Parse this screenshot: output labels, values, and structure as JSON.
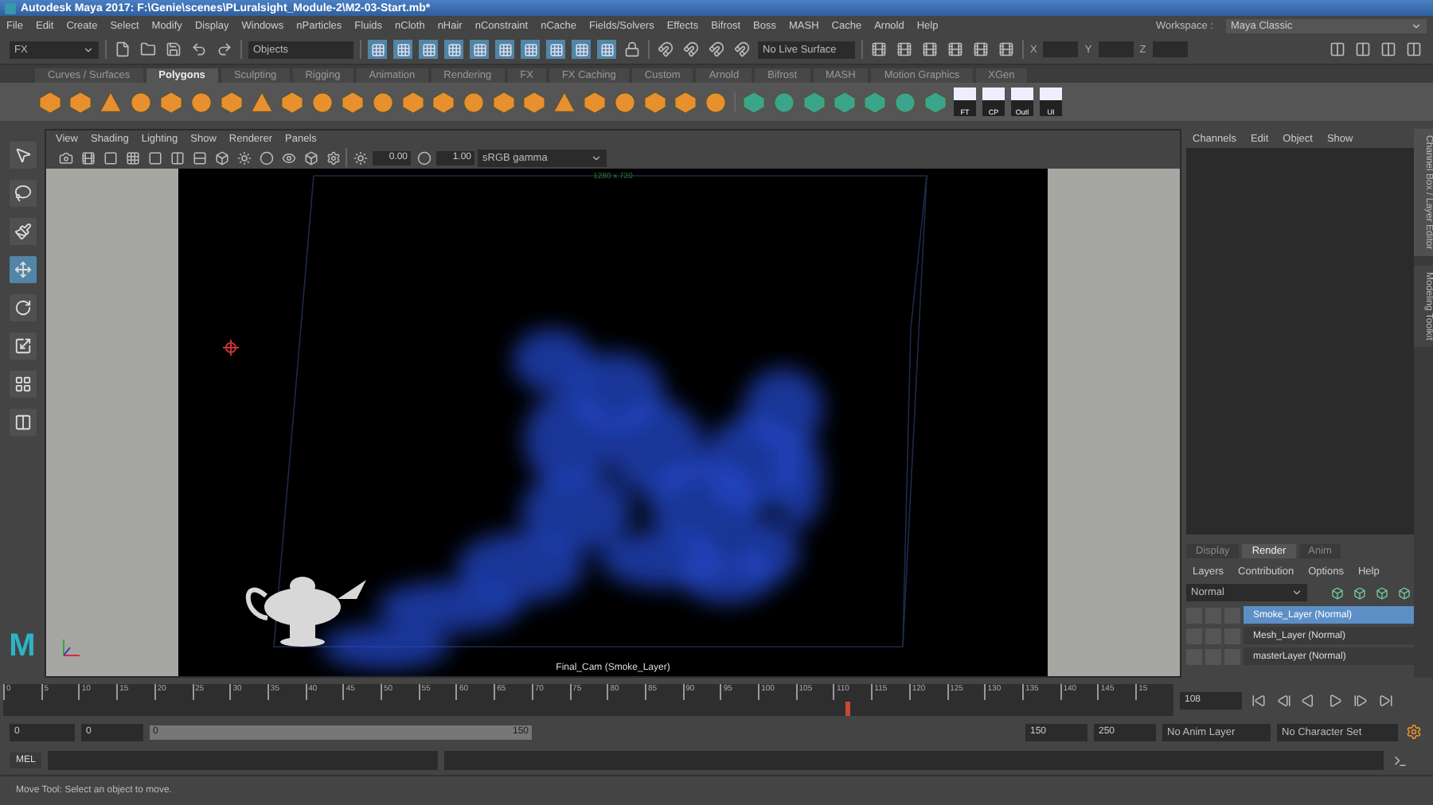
{
  "window": {
    "title": "Autodesk Maya 2017: F:\\Genie\\scenes\\PLuralsight_Module-2\\M2-03-Start.mb*"
  },
  "menu_bar": [
    "File",
    "Edit",
    "Create",
    "Select",
    "Modify",
    "Display",
    "Windows",
    "nParticles",
    "Fluids",
    "nCloth",
    "nHair",
    "nConstraint",
    "nCache",
    "Fields/Solvers",
    "Effects",
    "Bifrost",
    "Boss",
    "MASH",
    "Cache",
    "Arnold",
    "Help"
  ],
  "workspace": {
    "label": "Workspace :",
    "value": "Maya Classic"
  },
  "status_line": {
    "menu_set": "FX",
    "selection_mode": "Objects",
    "live_surface": "No Live Surface",
    "coordinate_labels": [
      "X",
      "Y",
      "Z"
    ]
  },
  "shelf_tabs": [
    {
      "label": "Curves / Surfaces",
      "selected": false
    },
    {
      "label": "Polygons",
      "selected": true
    },
    {
      "label": "Sculpting",
      "selected": false
    },
    {
      "label": "Rigging",
      "selected": false
    },
    {
      "label": "Animation",
      "selected": false
    },
    {
      "label": "Rendering",
      "selected": false
    },
    {
      "label": "FX",
      "selected": false
    },
    {
      "label": "FX Caching",
      "selected": false
    },
    {
      "label": "Custom",
      "selected": false
    },
    {
      "label": "Arnold",
      "selected": false
    },
    {
      "label": "Bifrost",
      "selected": false
    },
    {
      "label": "MASH",
      "selected": false
    },
    {
      "label": "Motion Graphics",
      "selected": false
    },
    {
      "label": "XGen",
      "selected": false
    }
  ],
  "shelf_labels": [
    "FT",
    "CP",
    "Outl",
    "UI"
  ],
  "tools": [
    {
      "kind": "select",
      "selected": false
    },
    {
      "kind": "lasso",
      "selected": false
    },
    {
      "kind": "paint",
      "selected": false
    },
    {
      "kind": "move",
      "selected": true
    },
    {
      "kind": "rotate",
      "selected": false
    },
    {
      "kind": "scale",
      "selected": false
    }
  ],
  "logo": "M",
  "viewport": {
    "menus": [
      "View",
      "Shading",
      "Lighting",
      "Show",
      "Renderer",
      "Panels"
    ],
    "exposure": "0.00",
    "gamma": "1.00",
    "color_space": "sRGB gamma",
    "resolution": "1280 x 720",
    "camera_label": "Final_Cam (Smoke_Layer)"
  },
  "channel_box": {
    "menus": [
      "Channels",
      "Edit",
      "Object",
      "Show"
    ]
  },
  "side_tabs": [
    "Channel Box / Layer Editor",
    "Modeling Toolkit"
  ],
  "layer_editor": {
    "tabs": [
      {
        "label": "Display",
        "selected": false
      },
      {
        "label": "Render",
        "selected": true
      },
      {
        "label": "Anim",
        "selected": false
      }
    ],
    "menus": [
      "Layers",
      "Contribution",
      "Options",
      "Help"
    ],
    "blend_mode": "Normal",
    "layers": [
      {
        "name": "Smoke_Layer (Normal)",
        "selected": true
      },
      {
        "name": "Mesh_Layer (Normal)",
        "selected": false
      },
      {
        "name": "masterLayer (Normal)",
        "selected": false
      }
    ]
  },
  "timeline": {
    "ticks": [
      "0",
      "5",
      "10",
      "15",
      "20",
      "25",
      "30",
      "35",
      "40",
      "45",
      "50",
      "55",
      "60",
      "65",
      "70",
      "75",
      "80",
      "85",
      "90",
      "95",
      "100",
      "105",
      "110",
      "115",
      "120",
      "125",
      "130",
      "135",
      "140",
      "145",
      "15"
    ],
    "current_frame": "108",
    "level": 0.72
  },
  "range": {
    "start": "0",
    "playback_start": "0",
    "slider_start": "0",
    "slider_end": "150",
    "level": 1,
    "playback_end": "150",
    "end": "250",
    "anim_layer": "No Anim Layer",
    "character_set": "No Character Set"
  },
  "command_line": {
    "language": "MEL"
  },
  "help_line": "Move Tool: Select an object to move."
}
